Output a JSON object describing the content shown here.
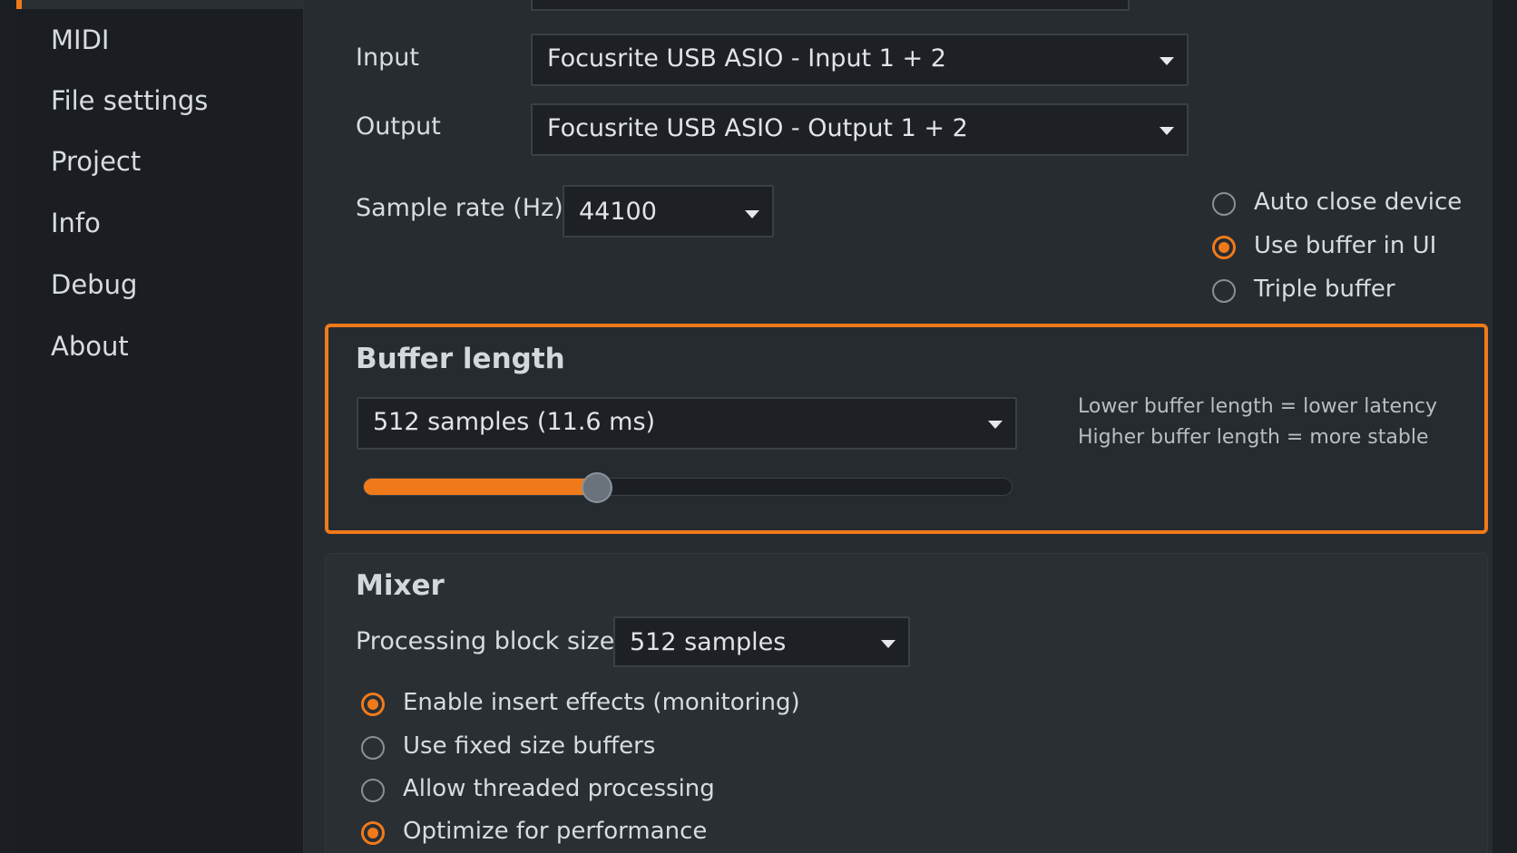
{
  "sidebar": {
    "items": [
      {
        "id": "midi",
        "label": "MIDI"
      },
      {
        "id": "file-settings",
        "label": "File settings"
      },
      {
        "id": "project",
        "label": "Project"
      },
      {
        "id": "info",
        "label": "Info"
      },
      {
        "id": "debug",
        "label": "Debug"
      },
      {
        "id": "about",
        "label": "About"
      }
    ]
  },
  "audio": {
    "input_label": "Input",
    "input_value": "Focusrite USB ASIO - Input 1 + 2",
    "output_label": "Output",
    "output_value": "Focusrite USB ASIO - Output 1 + 2",
    "sample_rate_label": "Sample rate (Hz)",
    "sample_rate_value": "44100",
    "options": [
      {
        "label": "Auto close device",
        "selected": false
      },
      {
        "label": "Use buffer in UI",
        "selected": true
      },
      {
        "label": "Triple buffer",
        "selected": false
      }
    ]
  },
  "buffer": {
    "title": "Buffer length",
    "value": "512 samples (11.6 ms)",
    "hint_line1": "Lower buffer length = lower latency",
    "hint_line2": "Higher buffer length = more stable",
    "slider_fraction": 0.36
  },
  "mixer": {
    "title": "Mixer",
    "block_size_label": "Processing block size",
    "block_size_value": "512 samples",
    "options": [
      {
        "label": "Enable insert effects (monitoring)",
        "selected": true
      },
      {
        "label": "Use fixed size buffers",
        "selected": false
      },
      {
        "label": "Allow threaded processing",
        "selected": false
      },
      {
        "label": "Optimize for performance",
        "selected": true
      }
    ]
  },
  "colors": {
    "accent": "#f07a1a",
    "background": "#272c31",
    "sidebar": "#1a1e22"
  }
}
